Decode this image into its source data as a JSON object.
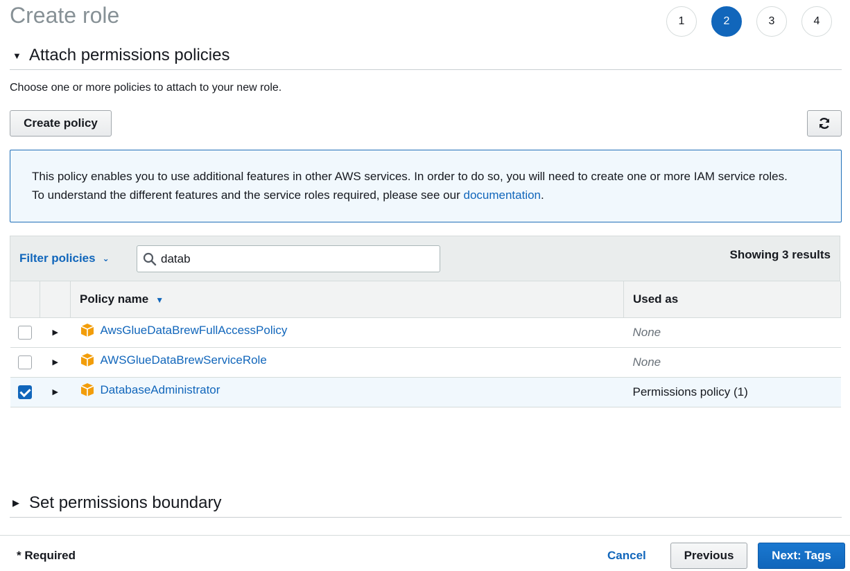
{
  "page": {
    "title": "Create role"
  },
  "steps": [
    "1",
    "2",
    "3",
    "4"
  ],
  "active_step": "2",
  "section_attach": {
    "title": "Attach permissions policies"
  },
  "intro": "Choose one or more policies to attach to your new role.",
  "create_policy_label": "Create policy",
  "info": {
    "line1": "This policy enables you to use additional features in other AWS services. In order to do so, you will need to create one or more IAM service roles.",
    "line2": "To understand the different features and the service roles required, please see our",
    "link": "documentation",
    "period": "."
  },
  "filter": {
    "label": "Filter policies",
    "search_value": "datab",
    "results": "Showing 3 results"
  },
  "table": {
    "columns": [
      "Policy name",
      "Used as"
    ],
    "rows": [
      {
        "name": "AwsGlueDataBrewFullAccessPolicy",
        "used_as": "None",
        "checked": false
      },
      {
        "name": "AWSGlueDataBrewServiceRole",
        "used_as": "None",
        "checked": false
      },
      {
        "name": "DatabaseAdministrator",
        "used_as": "Permissions policy (1)",
        "checked": true
      }
    ]
  },
  "section_boundary": {
    "title": "Set permissions boundary"
  },
  "footer": {
    "required": "* Required",
    "cancel": "Cancel",
    "previous": "Previous",
    "next": "Next: Tags"
  },
  "colors": {
    "accent": "#1166bb",
    "info_bg": "#f1f8fd",
    "policy_icon": "#f29d0a"
  },
  "icons": {
    "refresh": "refresh-icon",
    "search": "search-icon",
    "policy": "policy-box-icon"
  }
}
